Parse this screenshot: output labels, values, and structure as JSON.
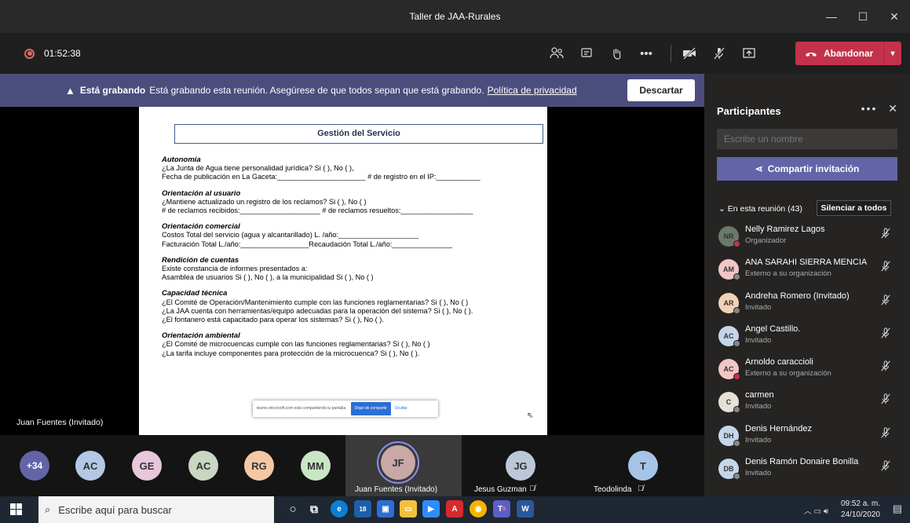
{
  "window": {
    "title": "Taller de JAA-Rurales",
    "controls": [
      "—",
      "☐",
      "✕"
    ]
  },
  "toolbar": {
    "timer": "01:52:38",
    "leave_label": "Abandonar"
  },
  "banner": {
    "bold": "Está grabando",
    "text": "Está grabando esta reunión. Asegúrese de que todos sepan que está grabando.",
    "link": "Política de privacidad",
    "dismiss": "Descartar"
  },
  "document": {
    "title": "Gestión del Servicio",
    "sections": [
      {
        "heading": "Autonomía",
        "lines": [
          "¿La Junta de Agua tiene personalidad jurídica? Si (  ), No (  ),",
          "Fecha de publicación en La Gaceta:______________________ # de registro en el IP:___________"
        ]
      },
      {
        "heading": "Orientación al usuario",
        "lines": [
          "¿Mantiene actualizado un registro de los reclamos? Si (  ), No (  )",
          "# de reclamos recibidos:____________________ # de reclamos resueltos:__________________"
        ]
      },
      {
        "heading": "Orientación comercial",
        "lines": [
          "Costos Total del servicio (agua y alcantarillado) L. /año:____________________",
          "Facturación Total L./año:_________________Recaudación Total L./año:_______________"
        ]
      },
      {
        "heading": "Rendición de cuentas",
        "lines": [
          "Existe constancia de informes presentados a:",
          "Asamblea de usuarios Si (  ), No (  ), a la municipalidad Si (  ), No (  )"
        ]
      },
      {
        "heading": "Capacidad técnica",
        "lines": [
          "¿El Comité de Operación/Mantenimiento cumple con las funciones reglamentarias? Si (  ), No (  )",
          "¿La JAA cuenta con herramientas/equipo adecuadas para la operación del sistema? Si (  ), No (  ).",
          "¿El fontanero está capacitado para operar los sistemas? Si (  ), No (  )."
        ]
      },
      {
        "heading": "Orientación ambiental",
        "lines": [
          "¿El Comité de microcuencas cumple con las funciones reglamentarias? Si (  ), No (  )",
          "¿La tarifa incluye componentes para protección de la microcuenca? Si (  ), No (  )."
        ]
      }
    ],
    "share_popup": {
      "text": "teams.microsoft.com está compartiendo tu pantalla.",
      "stop": "Dejar de compartir",
      "hide": "Ocultar"
    }
  },
  "presenter_label": "Juan Fuentes (Invitado)",
  "strip": {
    "overflow": "+34",
    "avatars": [
      {
        "initials": "AC",
        "color": "#b4c8e6"
      },
      {
        "initials": "GE",
        "color": "#e8c6dc"
      },
      {
        "initials": "AC",
        "color": "#c8d6c2"
      },
      {
        "initials": "RG",
        "color": "#f4c8a6"
      },
      {
        "initials": "MM",
        "color": "#c8e6c4"
      }
    ],
    "featured": [
      {
        "initials": "JF",
        "name": "Juan Fuentes (Invitado)",
        "color": "#c9a8a8"
      },
      {
        "initials": "JG",
        "name": "Jesus Guzman",
        "color": "#bcc8d8"
      },
      {
        "initials": "T",
        "name": "Teodolinda",
        "color": "#a6c4e6"
      }
    ]
  },
  "panel": {
    "title": "Participantes",
    "search_placeholder": "Escribe un nombre",
    "share_invite": "Compartir invitación",
    "in_meeting": "En esta reunión (43)",
    "mute_all": "Silenciar a todos",
    "participants": [
      {
        "initials": "NR",
        "name": "Nelly Ramirez Lagos",
        "role": "Organizador",
        "color": "#6a7a6a",
        "status": "#c4314b"
      },
      {
        "initials": "AM",
        "name": "ANA SARAHI SIERRA MENCIA",
        "role": "Externo a su organización",
        "color": "#f2c6c6",
        "status": "#888"
      },
      {
        "initials": "AR",
        "name": "Andreha Romero (Invitado)",
        "role": "Invitado",
        "color": "#f2d2b6",
        "status": "#888"
      },
      {
        "initials": "AC",
        "name": "Angel Castillo.",
        "role": "Invitado",
        "color": "#c6d6ea",
        "status": "#888"
      },
      {
        "initials": "AC",
        "name": "Arnoldo caraccioli",
        "role": "Externo a su organización",
        "color": "#f2c6c6",
        "status": "#c4314b"
      },
      {
        "initials": "C",
        "name": "carmen",
        "role": "Invitado",
        "color": "#e6e0d6",
        "status": "#888"
      },
      {
        "initials": "DH",
        "name": "Denis Hernández",
        "role": "Invitado",
        "color": "#c6d6ea",
        "status": "#888"
      },
      {
        "initials": "DB",
        "name": "Denis Ramón Donaire Bonilla",
        "role": "Invitado",
        "color": "#c6d6ea",
        "status": "#888"
      }
    ]
  },
  "taskbar": {
    "search_placeholder": "Escribe aquí para buscar",
    "time": "09:52 a. m.",
    "date": "24/10/2020",
    "teams_badge": "5",
    "mail_badge": "18"
  }
}
